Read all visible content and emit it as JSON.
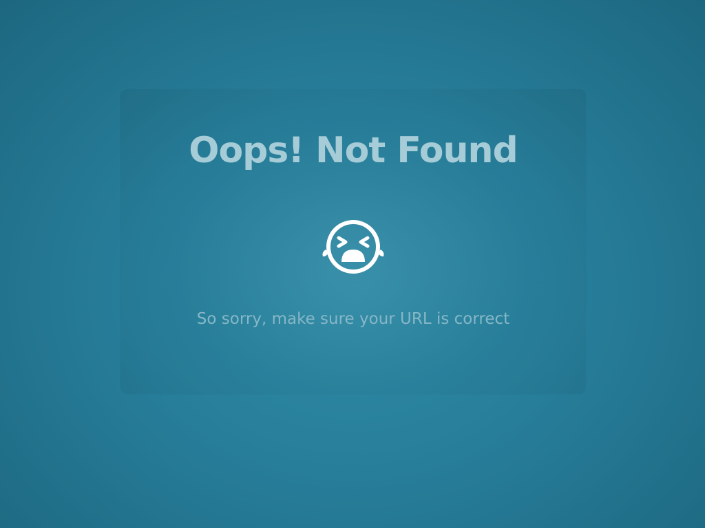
{
  "error_card": {
    "title": "Oops! Not Found",
    "icon": "crying-face-icon",
    "message": "So sorry, make sure your URL is correct"
  },
  "colors": {
    "background": "#277e9a",
    "title": "#a6ccd8",
    "message": "#86b7c7",
    "icon": "#ffffff"
  }
}
